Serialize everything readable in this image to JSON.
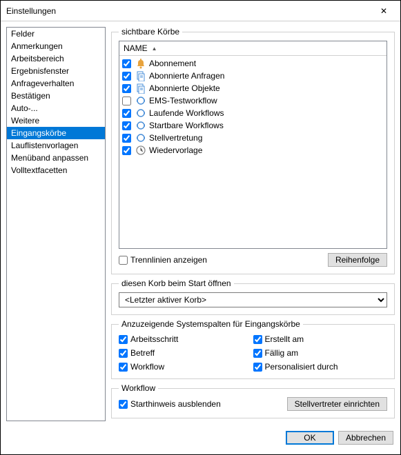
{
  "title": "Einstellungen",
  "close": "✕",
  "sidebar": {
    "items": [
      {
        "label": "Felder"
      },
      {
        "label": "Anmerkungen"
      },
      {
        "label": "Arbeitsbereich"
      },
      {
        "label": "Ergebnisfenster"
      },
      {
        "label": "Anfrageverhalten"
      },
      {
        "label": "Bestätigen"
      },
      {
        "label": "Auto-..."
      },
      {
        "label": "Weitere"
      },
      {
        "label": "Eingangskörbe"
      },
      {
        "label": "Lauflistenvorlagen"
      },
      {
        "label": "Menüband anpassen"
      },
      {
        "label": "Volltextfacetten"
      }
    ],
    "activeIndex": 8
  },
  "visibleBaskets": {
    "legend": "sichtbare Körbe",
    "header": "NAME",
    "items": [
      {
        "label": "Abonnement",
        "checked": true,
        "icon": "bell"
      },
      {
        "label": "Abonnierte Anfragen",
        "checked": true,
        "icon": "doc"
      },
      {
        "label": "Abonnierte Objekte",
        "checked": true,
        "icon": "doc"
      },
      {
        "label": "EMS-Testworkflow",
        "checked": false,
        "icon": "gear"
      },
      {
        "label": "Laufende Workflows",
        "checked": true,
        "icon": "gear"
      },
      {
        "label": "Startbare Workflows",
        "checked": true,
        "icon": "gear"
      },
      {
        "label": "Stellvertretung",
        "checked": true,
        "icon": "gear"
      },
      {
        "label": "Wiedervorlage",
        "checked": true,
        "icon": "clock"
      }
    ],
    "showSeparators": {
      "label": "Trennlinien anzeigen",
      "checked": false
    },
    "orderButton": "Reihenfolge"
  },
  "openOnStart": {
    "legend": "diesen Korb beim Start öffnen",
    "value": "<Letzter aktiver Korb>"
  },
  "systemCols": {
    "legend": "Anzuzeigende Systemspalten für Eingangskörbe",
    "items": [
      {
        "label": "Arbeitsschritt",
        "checked": true
      },
      {
        "label": "Erstellt am",
        "checked": true
      },
      {
        "label": "Betreff",
        "checked": true
      },
      {
        "label": "Fällig am",
        "checked": true
      },
      {
        "label": "Workflow",
        "checked": true
      },
      {
        "label": "Personalisiert durch",
        "checked": true
      }
    ]
  },
  "workflow": {
    "legend": "Workflow",
    "hideHint": {
      "label": "Starthinweis ausblenden",
      "checked": true
    },
    "deputyButton": "Stellvertreter einrichten"
  },
  "footer": {
    "ok": "OK",
    "cancel": "Abbrechen"
  }
}
